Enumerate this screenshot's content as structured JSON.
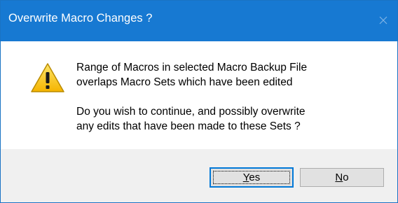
{
  "window": {
    "title": "Overwrite Macro Changes ?",
    "close_icon": "close-icon"
  },
  "message": {
    "line1": "Range of Macros in selected Macro Backup File",
    "line2": "overlaps Macro Sets which have been edited",
    "line3": "Do you wish to continue, and possibly overwrite",
    "line4": "any edits that have been made to these Sets ?"
  },
  "icon": {
    "name": "warning-icon"
  },
  "buttons": {
    "yes": {
      "mnemonic": "Y",
      "rest": "es"
    },
    "no": {
      "mnemonic": "N",
      "rest": "o"
    }
  },
  "colors": {
    "titlebar": "#1779d2",
    "button_bar": "#f0f0f0",
    "focus_border": "#0078d7"
  }
}
